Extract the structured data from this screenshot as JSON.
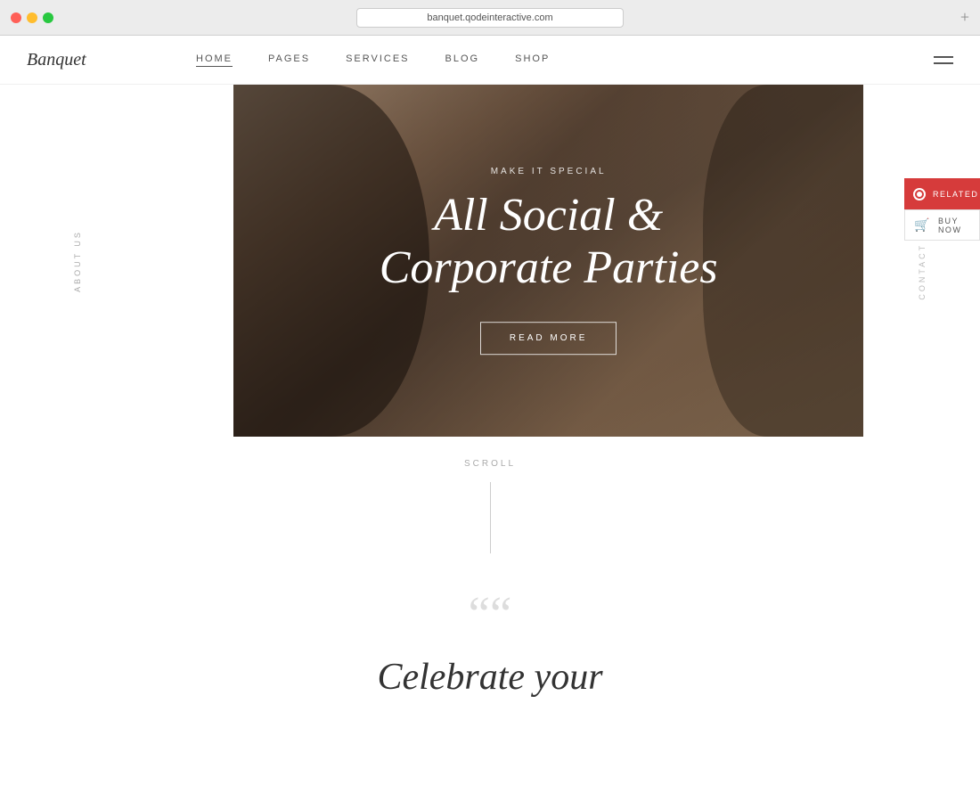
{
  "browser": {
    "url": "banquet.qodeinteractive.com",
    "plus_icon": "+"
  },
  "nav": {
    "logo": "Banquet",
    "links": [
      {
        "label": "HOME",
        "active": true
      },
      {
        "label": "PAGES",
        "active": false
      },
      {
        "label": "SERVICES",
        "active": false
      },
      {
        "label": "BLOG",
        "active": false
      },
      {
        "label": "SHOP",
        "active": false
      }
    ]
  },
  "hero": {
    "subtitle": "MAKE IT SPECIAL",
    "title_line1": "All Social &",
    "title_line2": "Corporate Parties",
    "cta_label": "READ MORE"
  },
  "sidebar_left": {
    "label": "ABOUT US"
  },
  "sidebar_right": {
    "label": "CONTACT US"
  },
  "float_buttons": {
    "related_label": "RELATED",
    "buy_label": "BUY NOW"
  },
  "scroll_section": {
    "label": "SCROLL"
  },
  "quote_section": {
    "marks": "““",
    "text": "Celebrate your"
  }
}
